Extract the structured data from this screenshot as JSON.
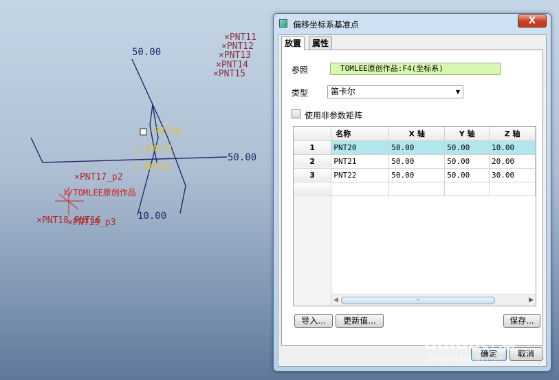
{
  "viewport": {
    "dimensions": [
      "50.00",
      "50.00",
      "10.00"
    ],
    "points_blue": [
      "×PNT11",
      "×PNT12",
      "×PNT13",
      "×PNT14",
      "×PNT15"
    ],
    "selected_point": "PNT20",
    "points_yellow": [
      "× PNT21",
      "× PNT22"
    ],
    "points_red": [
      "×PNT17_p2",
      "×PNT18 PNT16",
      "×PNT19_p3"
    ],
    "tomlee_tag": "X/TOMLEE原创作品"
  },
  "dialog": {
    "title": "偏移坐标系基准点",
    "close_label": "X",
    "tabs": [
      "放置",
      "属性"
    ],
    "ref_label": "参照",
    "ref_value": "TOMLEE原创作品:F4(坐标系)",
    "type_label": "类型",
    "type_value": "笛卡尔",
    "nonparam_label": "使用非参数矩阵",
    "nonparam_checked": false,
    "table": {
      "headers": [
        "名称",
        "X 轴",
        "Y 轴",
        "Z 轴"
      ],
      "rows": [
        {
          "index": "1",
          "name": "PNT20",
          "x": "50.00",
          "y": "50.00",
          "z": "10.00",
          "selected": true
        },
        {
          "index": "2",
          "name": "PNT21",
          "x": "50.00",
          "y": "50.00",
          "z": "20.00",
          "selected": false
        },
        {
          "index": "3",
          "name": "PNT22",
          "x": "50.00",
          "y": "50.00",
          "z": "30.00",
          "selected": false
        }
      ]
    },
    "buttons": {
      "import": "导入...",
      "update": "更新值...",
      "save": "保存...",
      "ok": "确定",
      "cancel": "取消"
    }
  },
  "watermark": {
    "main": "Baidu经验",
    "sub": "jingyan.baidu.com"
  },
  "colors": {
    "selected_row": "#b0e6ec",
    "ref_field": "#d9f7b3",
    "close_button": "#c9442a",
    "dimension_text": "#1f2a66",
    "selected_point": "#e0c040"
  }
}
